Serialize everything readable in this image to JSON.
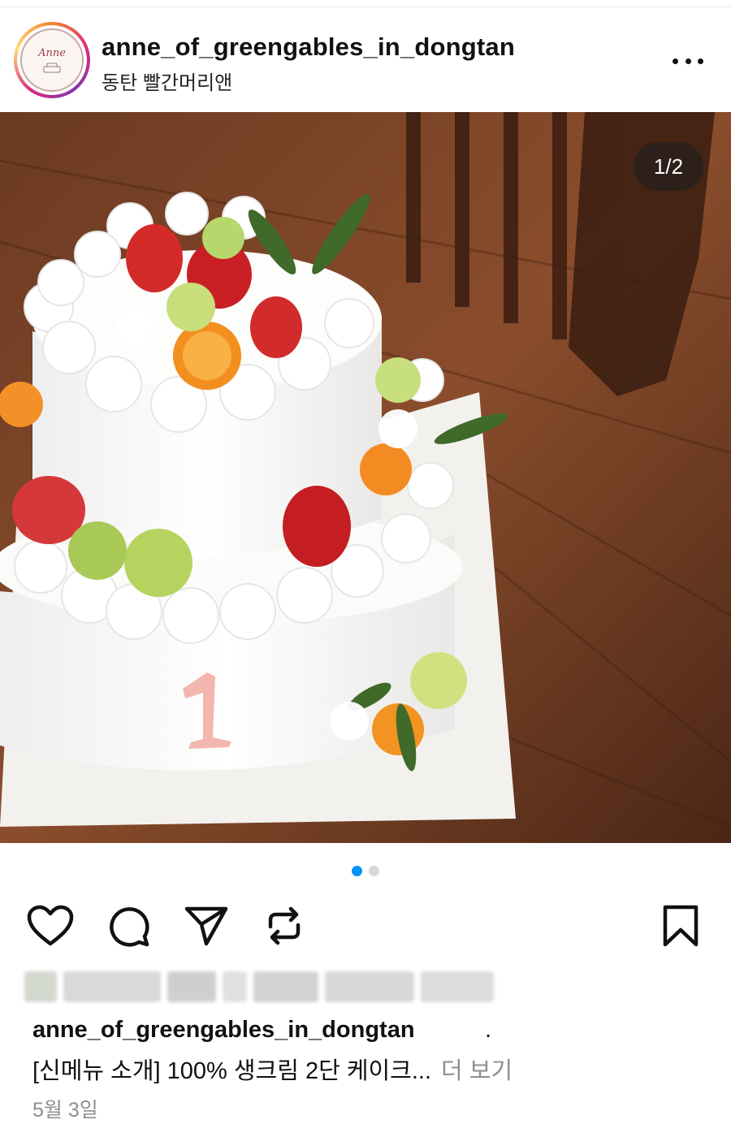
{
  "header": {
    "username": "anne_of_greengables_in_dongtan",
    "location": "동탄 빨간머리앤",
    "avatar_text": "Anne",
    "more_icon": "more-horizontal-icon"
  },
  "photo": {
    "counter": "1/2",
    "current_index": 1,
    "total": 2,
    "candle_number": "1"
  },
  "pager": {
    "dots": 2,
    "active": 0,
    "active_color": "#0095f6",
    "inactive_color": "#d8d8d8"
  },
  "actions": {
    "like_icon": "heart-icon",
    "comment_icon": "comment-icon",
    "share_icon": "send-icon",
    "repost_icon": "repost-icon",
    "save_icon": "bookmark-icon"
  },
  "caption": {
    "username": "anne_of_greengables_in_dongtan",
    "separator": ".",
    "text": "[신메뉴 소개] 100% 생크림 2단 케이크...",
    "more_label": "더 보기"
  },
  "date": "5월 3일"
}
